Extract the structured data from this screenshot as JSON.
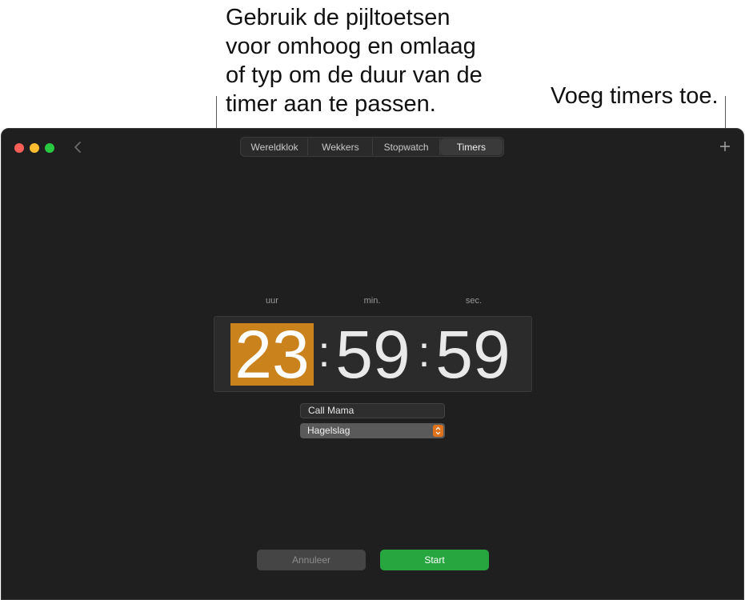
{
  "callouts": {
    "left": "Gebruik de pijltoetsen\nvoor omhoog en omlaag\nof typ om de duur van de\ntimer aan te passen.",
    "right": "Voeg timers toe."
  },
  "tabs": [
    {
      "label": "Wereldklok"
    },
    {
      "label": "Wekkers"
    },
    {
      "label": "Stopwatch"
    },
    {
      "label": "Timers",
      "active": true
    }
  ],
  "timer": {
    "labels": {
      "hours": "uur",
      "minutes": "min.",
      "seconds": "sec."
    },
    "hours": "23",
    "minutes": "59",
    "seconds": "59",
    "separator": ":",
    "name": "Call Mama",
    "sound": "Hagelslag"
  },
  "buttons": {
    "cancel": "Annuleer",
    "start": "Start"
  },
  "icons": {
    "back": "chevron-left-icon",
    "add": "plus-icon",
    "stepper": "up-down-chevron-icon"
  },
  "colors": {
    "selected_digit": "#c9821c",
    "start_button": "#27a640",
    "stepper": "#e0721c",
    "window_bg": "#1f1f1f"
  }
}
